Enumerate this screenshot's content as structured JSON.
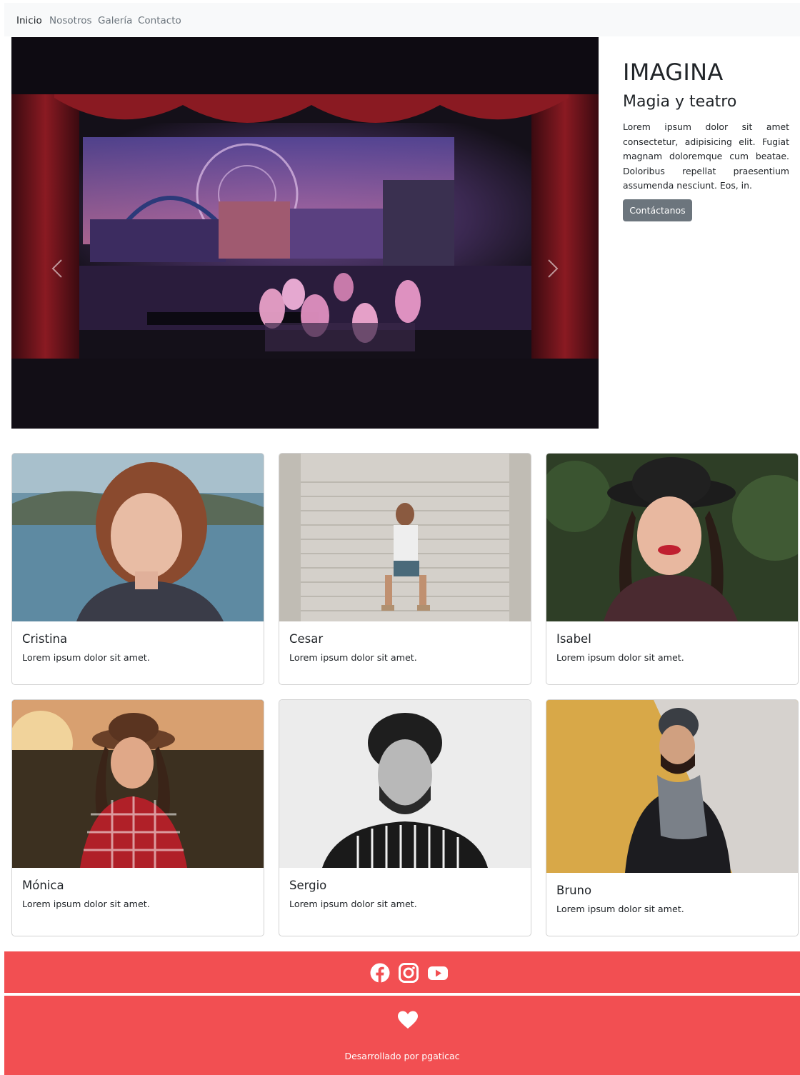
{
  "navbar": {
    "items": [
      "Inicio",
      "Nosotros",
      "Galería",
      "Contacto"
    ],
    "active_index": 0
  },
  "hero": {
    "title": "IMAGINA",
    "subtitle": "Magia y teatro",
    "body": "Lorem ipsum dolor sit amet consectetur, adipisicing elit. Fugiat magnam doloremque cum beatae. Doloribus repellat praesentium assumenda nesciunt. Eos, in.",
    "button_label": "Contáctanos",
    "carousel": {
      "slide_count": 3,
      "active_slide": 2
    }
  },
  "cards": [
    {
      "name": "Cristina",
      "text": "Lorem ipsum dolor sit amet."
    },
    {
      "name": "Cesar",
      "text": "Lorem ipsum dolor sit amet."
    },
    {
      "name": "Isabel",
      "text": "Lorem ipsum dolor sit amet."
    },
    {
      "name": "Mónica",
      "text": "Lorem ipsum dolor sit amet."
    },
    {
      "name": "Sergio",
      "text": "Lorem ipsum dolor sit amet."
    },
    {
      "name": "Bruno",
      "text": "Lorem ipsum dolor sit amet."
    }
  ],
  "footer": {
    "social_icons": [
      "facebook-icon",
      "instagram-icon",
      "youtube-icon"
    ],
    "heart_icon": "heart-icon",
    "credit": "Desarrollado por pgaticac",
    "color": "#f24f52"
  },
  "colors": {
    "navbar_bg": "#f8f9fa",
    "button_bg": "#6c757d",
    "text": "#212529"
  }
}
